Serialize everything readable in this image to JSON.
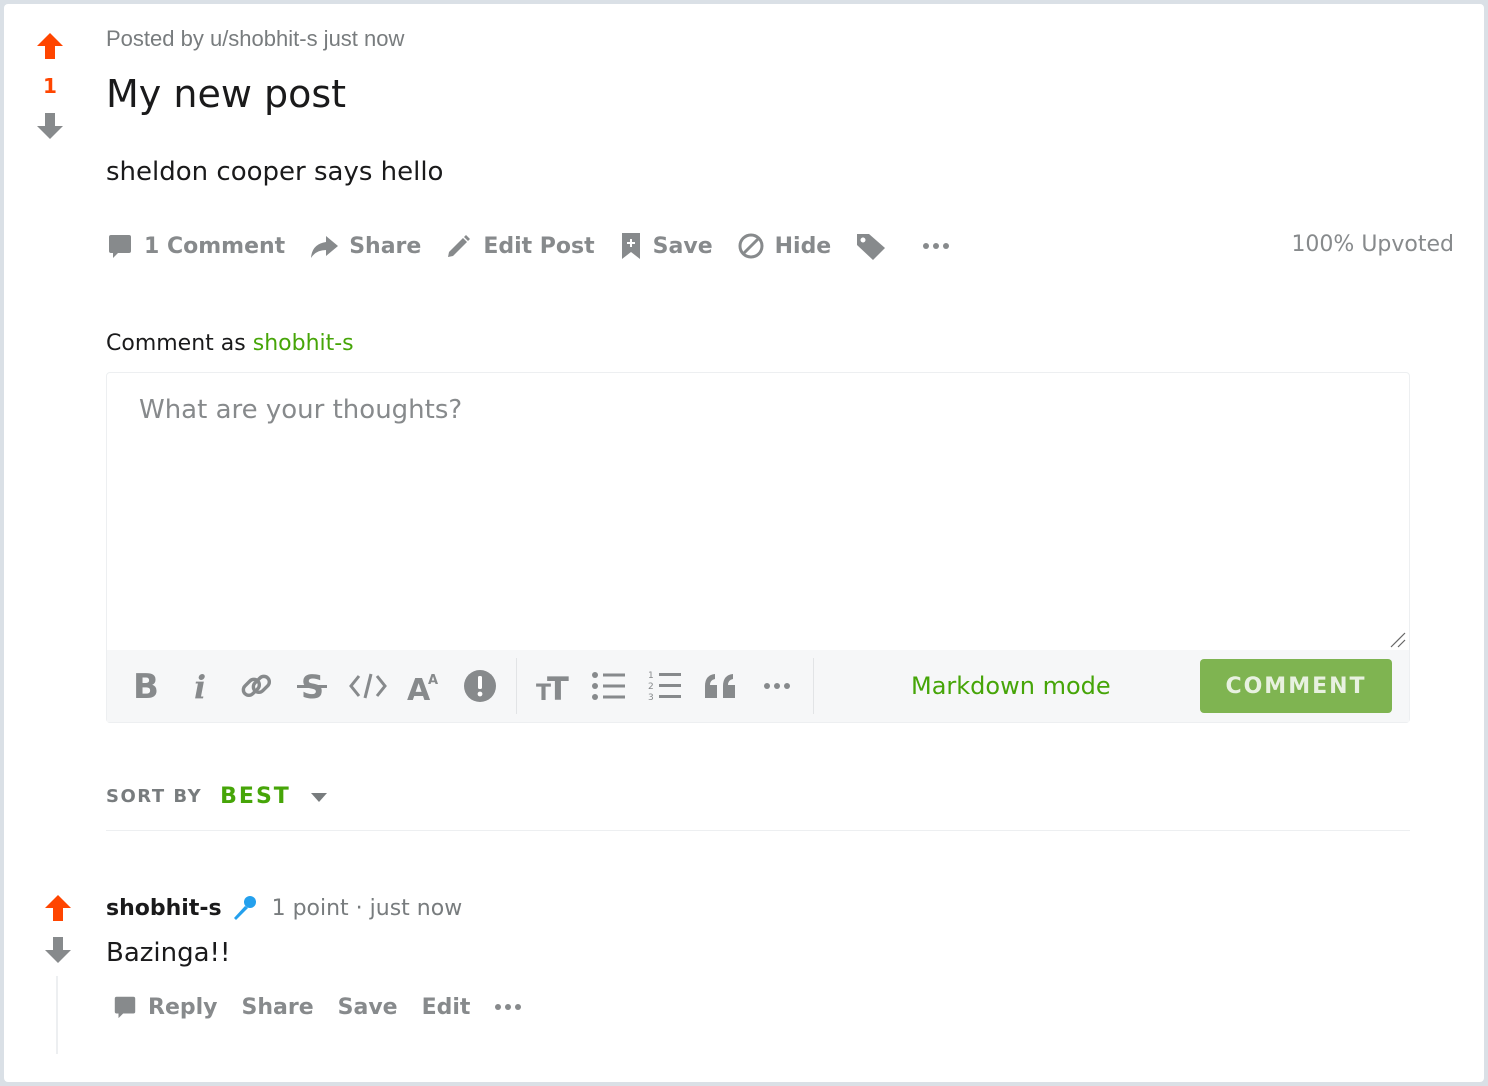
{
  "post": {
    "score": "1",
    "meta": "Posted by u/shobhit-s just now",
    "title": "My new post",
    "body": "sheldon cooper says hello",
    "actions": {
      "comments": "1 Comment",
      "share": "Share",
      "edit": "Edit Post",
      "save": "Save",
      "hide": "Hide"
    },
    "upvoted": "100% Upvoted"
  },
  "composer": {
    "comment_as_prefix": "Comment as",
    "username": "shobhit-s",
    "placeholder": "What are your thoughts?",
    "markdown_mode": "Markdown mode",
    "submit_label": "COMMENT"
  },
  "sort": {
    "label": "SORT BY",
    "value": "BEST"
  },
  "comment": {
    "author": "shobhit-s",
    "meta": "1 point · just now",
    "body": "Bazinga!!",
    "actions": {
      "reply": "Reply",
      "share": "Share",
      "save": "Save",
      "edit": "Edit"
    }
  },
  "colors": {
    "upvote": "#ff4500",
    "accent_green": "#46a508",
    "comment_button": "#7fb451",
    "icon_grey": "#878a8c"
  }
}
